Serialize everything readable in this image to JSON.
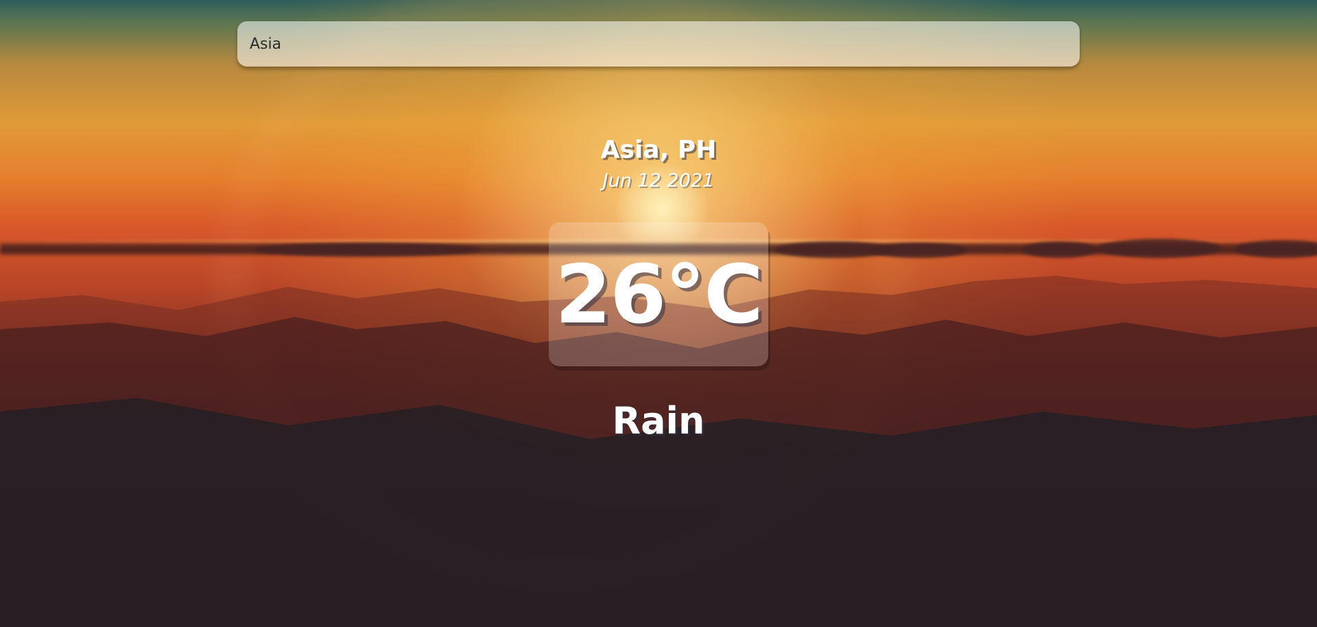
{
  "search": {
    "value": "Asia"
  },
  "location": {
    "name": "Asia, PH",
    "date": "Jun 12 2021"
  },
  "weather": {
    "temperature": "26°C",
    "condition": "Rain"
  }
}
